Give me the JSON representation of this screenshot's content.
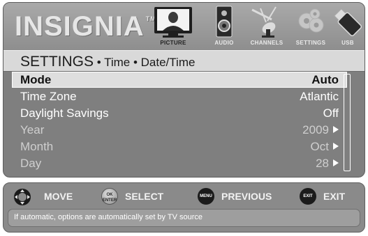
{
  "brand": {
    "name": "INSIGNIA",
    "trademark": "TM"
  },
  "tabs": [
    {
      "label": "PICTURE",
      "icon": "tv-icon",
      "active": true
    },
    {
      "label": "AUDIO",
      "icon": "speaker-icon",
      "active": false
    },
    {
      "label": "CHANNELS",
      "icon": "satellite-dish-icon",
      "active": false
    },
    {
      "label": "SETTINGS",
      "icon": "gears-icon",
      "active": false
    },
    {
      "label": "USB",
      "icon": "usb-drive-icon",
      "active": false
    }
  ],
  "breadcrumb": {
    "title": "SETTINGS",
    "path": " • Time • Date/Time"
  },
  "settings": [
    {
      "label": "Mode",
      "value": "Auto",
      "selected": true,
      "dimmed": false,
      "has_arrow": false
    },
    {
      "label": "Time Zone",
      "value": "Atlantic",
      "selected": false,
      "dimmed": false,
      "has_arrow": false
    },
    {
      "label": "Daylight Savings",
      "value": "Off",
      "selected": false,
      "dimmed": false,
      "has_arrow": false
    },
    {
      "label": "Year",
      "value": "2009",
      "selected": false,
      "dimmed": true,
      "has_arrow": true
    },
    {
      "label": "Month",
      "value": "Oct",
      "selected": false,
      "dimmed": true,
      "has_arrow": true
    },
    {
      "label": "Day",
      "value": "28",
      "selected": false,
      "dimmed": true,
      "has_arrow": true
    }
  ],
  "help": {
    "move_label": "MOVE",
    "select_label": "SELECT",
    "ok_button_text": "OK\nENTER",
    "previous_label": "PREVIOUS",
    "menu_button_text": "MENU",
    "exit_label": "EXIT",
    "exit_button_text": "EXIT",
    "hint": "If automatic, options are automatically set by TV source"
  },
  "colors": {
    "panel_bg": "#7f7f7f",
    "selected_row_bg": "#dedede",
    "breadcrumb_bg": "#d9d9d9"
  }
}
